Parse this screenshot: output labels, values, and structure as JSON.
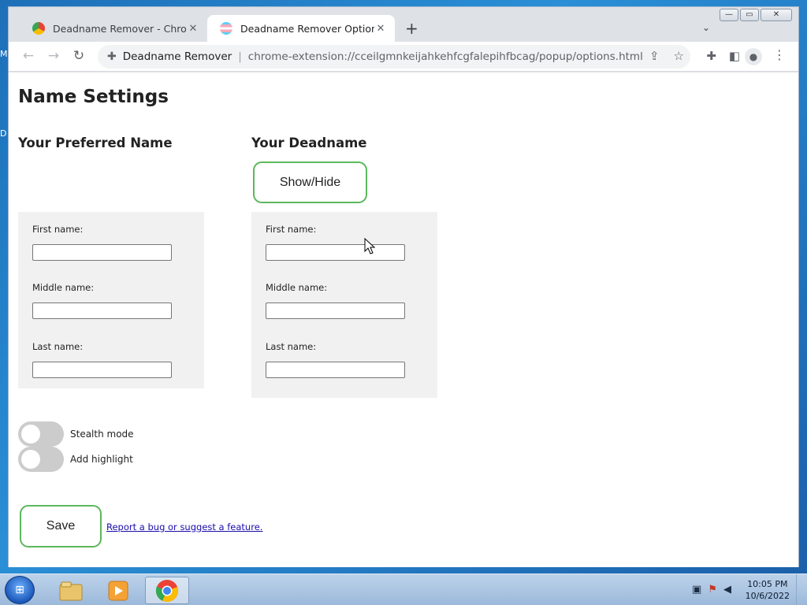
{
  "desktop": {
    "edge_glyphs": [
      "M",
      "D"
    ]
  },
  "window": {
    "controls": {
      "minimize": "—",
      "maximize": "▭",
      "close": "✕"
    }
  },
  "tabs": [
    {
      "title": "Deadname Remover - Chrome W",
      "close": "✕",
      "active": false
    },
    {
      "title": "Deadname Remover Options",
      "close": "✕",
      "active": true
    }
  ],
  "tabstrip": {
    "new_tab": "+",
    "tab_search": "⌄"
  },
  "toolbar": {
    "back": "←",
    "forward": "→",
    "reload": "↻",
    "site_name": "Deadname Remover",
    "url": "chrome-extension://cceilgmnkeijahkehfcgfalepihfbcag/popup/options.html",
    "share": "⇪",
    "bookmark": "☆",
    "extensions": "✚",
    "side_panel": "◧",
    "profile": "●",
    "menu": "⋮"
  },
  "page": {
    "title": "Name Settings",
    "preferred": {
      "heading": "Your Preferred Name",
      "fields": [
        {
          "label": "First name:",
          "value": ""
        },
        {
          "label": "Middle name:",
          "value": ""
        },
        {
          "label": "Last name:",
          "value": ""
        }
      ]
    },
    "deadname": {
      "heading": "Your Deadname",
      "show_hide_label": "Show/Hide",
      "fields": [
        {
          "label": "First name:",
          "value": ""
        },
        {
          "label": "Middle name:",
          "value": ""
        },
        {
          "label": "Last name:",
          "value": ""
        }
      ]
    },
    "toggles": [
      {
        "label": "Stealth mode",
        "on": false
      },
      {
        "label": "Add highlight",
        "on": false
      }
    ],
    "save_label": "Save",
    "report_link": "Report a bug or suggest a feature."
  },
  "taskbar": {
    "apps": [
      "file-explorer-icon",
      "media-player-icon",
      "chrome-icon"
    ],
    "clock_time": "10:05 PM",
    "clock_date": "10/6/2022"
  },
  "colors": {
    "accent_green": "#5cb85c",
    "panel_bg": "#f1f1f1",
    "link": "#1a0dab"
  }
}
